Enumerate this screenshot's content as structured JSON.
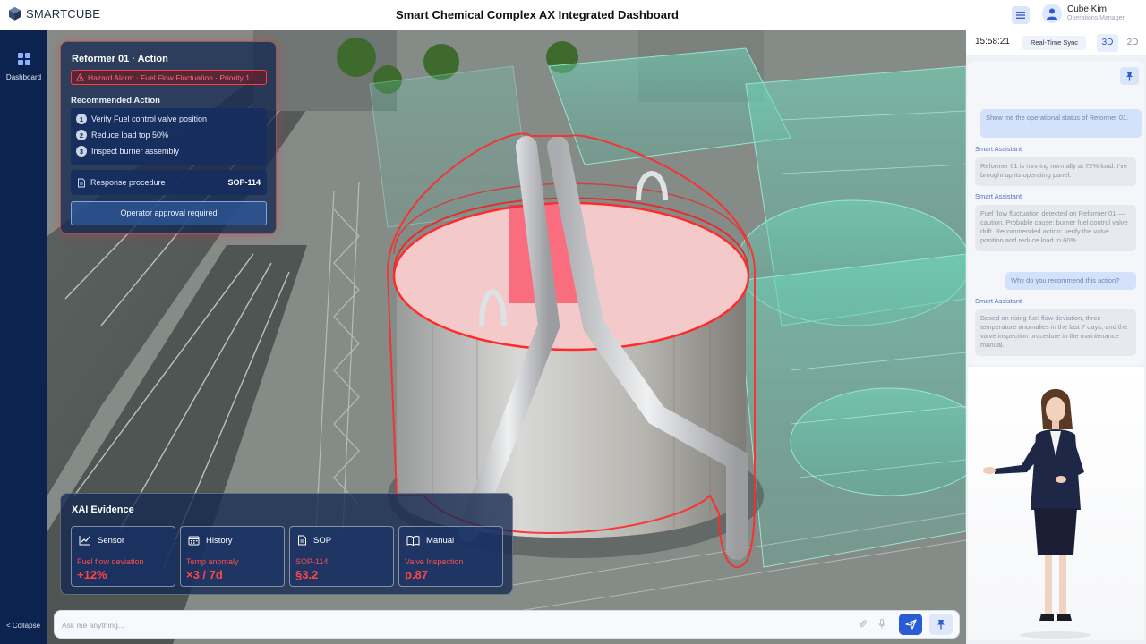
{
  "header": {
    "brand": "SMARTCUBE",
    "title": "Smart Chemical Complex AX Integrated Dashboard",
    "user_name": "Cube Kim",
    "user_role": "Operations Manager"
  },
  "sidebar": {
    "items": [
      {
        "label": "Dashboard",
        "icon": "dashboard-grid-icon"
      }
    ],
    "collapse_label": "< Collapse"
  },
  "action_panel": {
    "title": "Reformer 01 · Action",
    "alarm": "Hazard Alarm · Fuel Flow Fluctuation · Priority 1",
    "recommended_heading": "Recommended Action",
    "steps": [
      {
        "num": "1",
        "text": "Verify Fuel control valve position"
      },
      {
        "num": "2",
        "text": "Reduce load top 50%"
      },
      {
        "num": "3",
        "text": "Inspect burner assembly"
      }
    ],
    "procedure_label": "Response procedure",
    "procedure_code": "SOP-114",
    "approval": "Operator approval required"
  },
  "xai": {
    "title": "XAI Evidence",
    "cards": [
      {
        "name": "Sensor",
        "label": "Fuel flow deviation",
        "value": "+12%",
        "icon": "line-chart-icon"
      },
      {
        "name": "History",
        "label": "Temp anomaly",
        "value": "×3 / 7d",
        "icon": "calendar-icon"
      },
      {
        "name": "SOP",
        "label": "SOP-114",
        "value": "§3.2",
        "icon": "document-icon"
      },
      {
        "name": "Manual",
        "label": "Valve Inspection",
        "value": "p.87",
        "icon": "book-icon"
      }
    ]
  },
  "right_rail": {
    "time": "15:58:21",
    "sync": "Real-Time Sync",
    "mode_3d": "3D",
    "mode_2d": "2D"
  },
  "chat": {
    "messages": [
      {
        "role": "user",
        "text": "Show me the operational status of Reformer 01."
      },
      {
        "role": "assistant",
        "sender": "Smart Assistant",
        "text": "Reformer 01 is running normally at 72% load. I've brought up its operating panel."
      },
      {
        "role": "assistant",
        "sender": "Smart Assistant",
        "text": "Fuel flow fluctuation detected on Reformer 01 — caution. Probable cause: burner fuel control valve drift. Recommended action: verify the valve position and reduce load to 60%."
      },
      {
        "role": "user",
        "text": "Why do you recommend this action?"
      },
      {
        "role": "assistant",
        "sender": "Smart Assistant",
        "text": "Based on rising fuel flow deviation, three temperature anomalies in the last 7 days, and the valve inspection procedure in the maintenance manual."
      }
    ]
  },
  "input": {
    "placeholder": "Ask me anything..."
  },
  "colors": {
    "alarm_red": "#ff3b3b",
    "accent_blue": "#2a5bd6",
    "sidebar_bg": "#0c2350"
  }
}
